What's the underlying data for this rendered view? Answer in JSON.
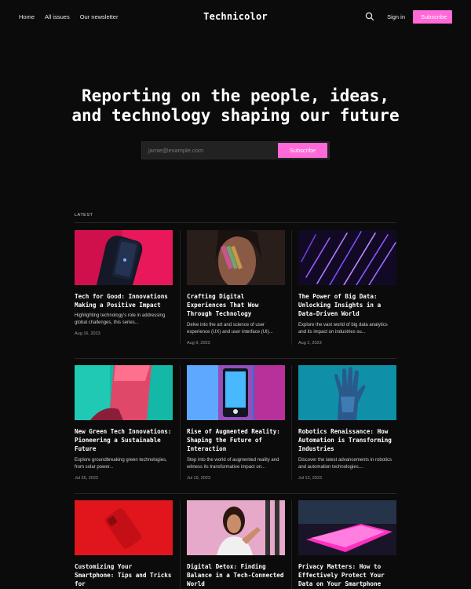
{
  "nav": {
    "home": "Home",
    "all_issues": "All issues",
    "newsletter": "Our newsletter",
    "brand": "Technicolor",
    "search_icon": "search-icon",
    "sign_in": "Sign in",
    "subscribe": "Subscribe"
  },
  "hero": {
    "title_line1": "Reporting on the people, ideas,",
    "title_line2": "and technology shaping our future",
    "email_placeholder": "jamie@example.com",
    "subscribe": "Subscribe"
  },
  "section": {
    "label": "LATEST"
  },
  "colors": {
    "accent": "#ff69d8",
    "background": "#0b0b0b"
  },
  "posts": [
    {
      "title": "Tech for Good: Innovations Making a Positive Impact",
      "desc": "Highlighting technology's role in addressing global challenges, this series...",
      "date": "Aug 16, 2023"
    },
    {
      "title": "Crafting Digital Experiences That Wow Through Technology",
      "desc": "Delve into the art and science of user experience (UX) and user interface (UI)...",
      "date": "Aug 9, 2023"
    },
    {
      "title": "The Power of Big Data: Unlocking Insights in a Data-Driven World",
      "desc": "Explore the vast world of big data analytics and its impact on industries su...",
      "date": "Aug 2, 2023"
    },
    {
      "title": "New Green Tech Innovations: Pioneering a Sustainable Future",
      "desc": "Explore groundbreaking green technologies, from solar power...",
      "date": "Jul 26, 2023"
    },
    {
      "title": "Rise of Augmented Reality: Shaping the Future of Interaction",
      "desc": "Step into the world of augmented reality and witness its transformative impact on...",
      "date": "Jul 19, 2023"
    },
    {
      "title": "Robotics Renaissance: How Automation is Transforming Industries",
      "desc": "Discover the latest advancements in robotics and automation technologies....",
      "date": "Jul 12, 2023"
    },
    {
      "title": "Customizing Your Smartphone: Tips and Tricks for",
      "desc": "",
      "date": ""
    },
    {
      "title": "Digital Detox: Finding Balance in a Tech-Connected World",
      "desc": "",
      "date": ""
    },
    {
      "title": "Privacy Matters: How to Effectively Protect Your Data on Your Smartphone",
      "desc": "",
      "date": ""
    }
  ]
}
